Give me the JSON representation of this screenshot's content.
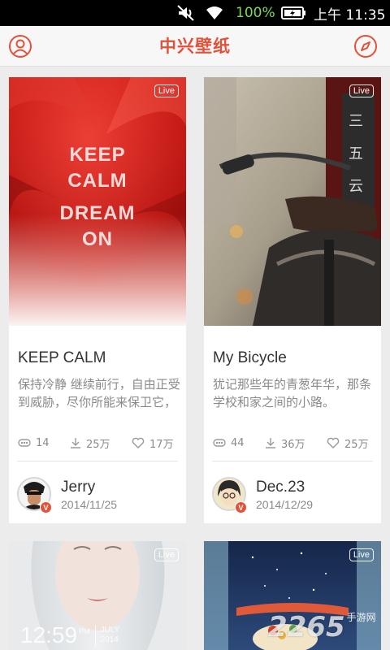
{
  "status_bar": {
    "battery_percent": "100%",
    "time": "上午 11:35",
    "icons": [
      "mute-icon",
      "wifi-icon",
      "battery-icon"
    ]
  },
  "header": {
    "title": "中兴壁纸",
    "left_icon": "user-icon",
    "right_icon": "compass-icon",
    "accent_color": "#e2513a"
  },
  "cards": [
    {
      "badge": "Live",
      "image_text": [
        "KEEP",
        "CALM",
        "DREAM",
        "ON"
      ],
      "title": "KEEP CALM",
      "description": "保持冷静 继续前行，自由正受到威胁，尽你所能来保卫它，",
      "stats": {
        "views": "14",
        "downloads": "25万",
        "likes": "17万"
      },
      "author": {
        "name": "Jerry",
        "date": "2014/11/25",
        "verified_badge": "V"
      }
    },
    {
      "badge": "Live",
      "title": "My Bicycle",
      "description": "犹记那些年的青葱年华，那条学校和家之间的小路。",
      "stats": {
        "views": "44",
        "downloads": "36万",
        "likes": "25万"
      },
      "author": {
        "name": "Dec.23",
        "date": "2014/12/29",
        "verified_badge": "V"
      }
    },
    {
      "badge": "Live",
      "clock_time": "12:59",
      "clock_ampm": "PM",
      "clock_date_top": "JULY",
      "clock_date_bottom": "2014"
    },
    {
      "badge": "Live"
    }
  ],
  "watermark": {
    "number": "2265",
    "text": "手游网"
  }
}
